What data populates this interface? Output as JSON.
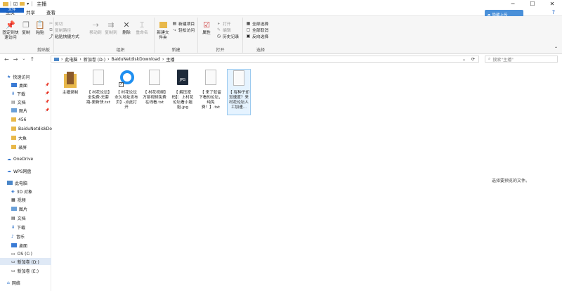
{
  "window": {
    "title": "主播"
  },
  "tabs": [
    "文件",
    "主页",
    "共享",
    "查看"
  ],
  "ribbon": {
    "clipboard": {
      "pin": "固定到快速访问",
      "copy": "复制",
      "paste": "粘贴",
      "cut": "剪切",
      "copy_path": "复制路径",
      "paste_shortcut": "粘贴快捷方式",
      "label": "剪贴板"
    },
    "organize": {
      "move_to": "移动到",
      "copy_to": "复制到",
      "delete": "删除",
      "rename": "重命名",
      "label": "组织"
    },
    "new": {
      "new_folder": "新建文件夹",
      "new_item": "新建项目",
      "easy_access": "轻松访问",
      "label": "新建"
    },
    "open": {
      "properties": "属性",
      "open": "打开",
      "edit": "编辑",
      "history": "历史记录",
      "label": "打开"
    },
    "select": {
      "select_all": "全部选择",
      "select_none": "全部取消",
      "invert": "反向选择",
      "label": "选择"
    }
  },
  "baidu_button": "隐藏上传",
  "address": {
    "crumbs": [
      "此电脑",
      "新加卷 (D:)",
      "BaiduNetdiskDownload",
      "主播"
    ],
    "search_placeholder": "搜索\"主播\""
  },
  "nav": {
    "quick_access": "快速访问",
    "quick": [
      "桌面",
      "下载",
      "文档",
      "图片",
      "456",
      "BaiduNetdiskDo",
      "大鱼",
      "录屏"
    ],
    "onedrive": "OneDrive",
    "wps": "WPS网盘",
    "this_pc": "此电脑",
    "pc": [
      "3D 对象",
      "视频",
      "图片",
      "文档",
      "下载",
      "音乐",
      "桌面",
      "OS (C:)",
      "新加卷 (D:)",
      "新加卷 (E:)"
    ],
    "network": "网络"
  },
  "files": [
    {
      "name": "主播录制",
      "type": "folder"
    },
    {
      "name": "【 村花论坛】全免费-无套路-更新快.txt",
      "type": "txt"
    },
    {
      "name": "【 村花论坛永久地址发布页】-点此打开",
      "type": "link"
    },
    {
      "name": "【 村花视频】万部视频免费在线看.txt",
      "type": "txt"
    },
    {
      "name": "【 解压密码】：上村花论坛看小姐姐.jpg",
      "type": "jpg"
    },
    {
      "name": "【 来了就留下看的论坛，纯免费！】.txt",
      "type": "txt"
    },
    {
      "name": "【 有种子却没速度？来村花论坛人工加速...",
      "type": "txt"
    }
  ],
  "preview_text": "选择要预览的文件。",
  "colors": {
    "accent": "#1a63c7",
    "folder": "#e8b84a"
  }
}
